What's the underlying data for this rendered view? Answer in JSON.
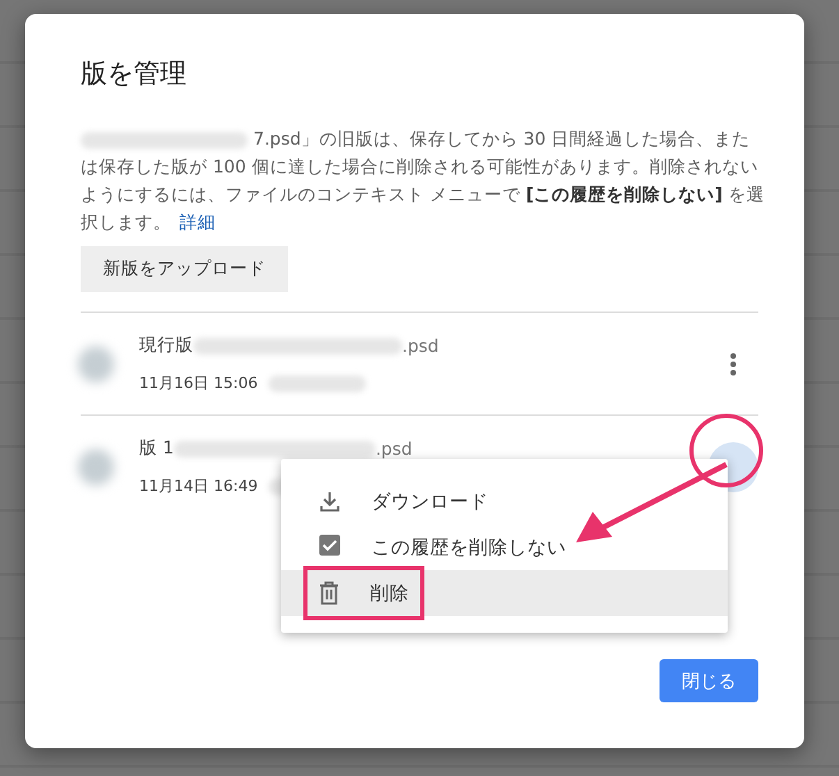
{
  "dialog": {
    "title": "版を管理",
    "description": {
      "redacted_prefix": true,
      "text": "7.psd」の旧版は、保存してから 30 日間経過した場合、または保存した版が 100 個に達した場合に削除される可能性があります。削除されないようにするには、ファイルのコンテキスト メニューで **[この履歴を削除しない]** を選択します。",
      "link": "詳細"
    },
    "upload_button": "新版をアップロード",
    "versions": [
      {
        "label": "現行版",
        "extension": ".psd",
        "date": "11月16日 15:06",
        "menu_open": false,
        "circled": false
      },
      {
        "label": "版 1",
        "extension": ".psd",
        "date": "11月14日 16:49",
        "menu_open": true,
        "circled": true
      }
    ],
    "menu": [
      {
        "kind": "download",
        "label": "ダウンロード",
        "selected": false,
        "framed": false
      },
      {
        "kind": "checkbox",
        "label": "この履歴を削除しない",
        "checked": true,
        "selected": false,
        "framed": false
      },
      {
        "kind": "delete",
        "label": "削除",
        "selected": true,
        "framed": true
      }
    ],
    "close_button": "閉じる"
  }
}
